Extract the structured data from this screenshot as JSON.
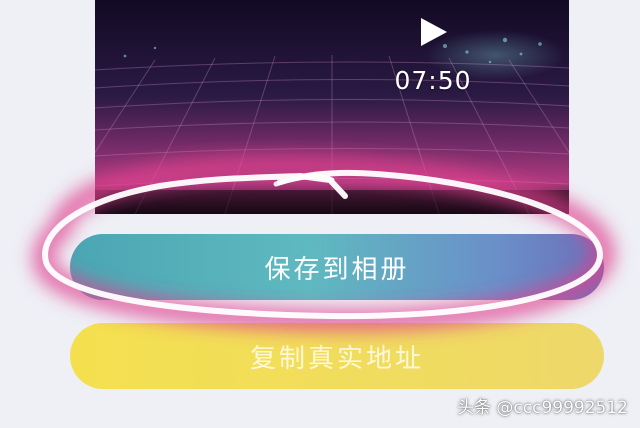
{
  "video": {
    "duration": "07:50",
    "icon": "play-icon"
  },
  "actions": {
    "save_label": "保存到相册",
    "copy_label": "复制真实地址"
  },
  "watermark": {
    "text": "头条 @ccc99992512"
  },
  "colors": {
    "background": "#eef0f6",
    "save_start": "#4aa6b3",
    "save_end": "#6d6fb7",
    "copy": "#f4e04e",
    "highlight_glow": "#e0408f"
  }
}
